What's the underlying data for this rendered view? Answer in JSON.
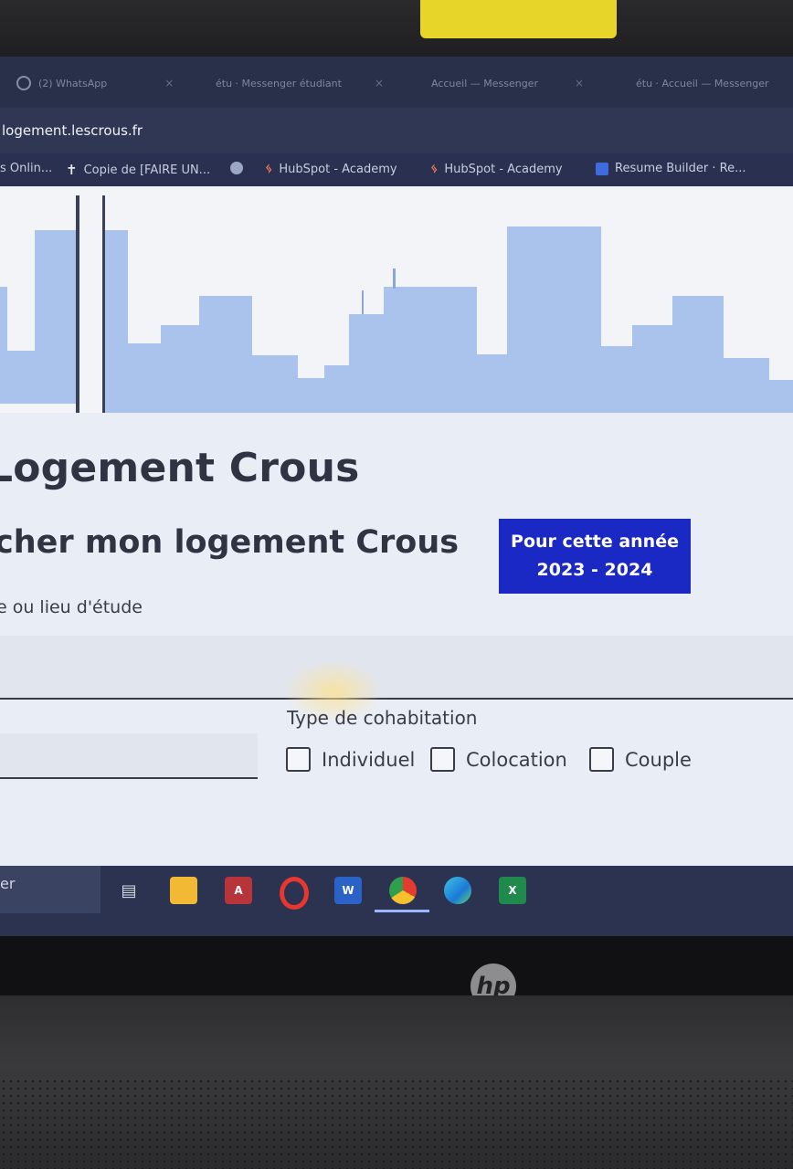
{
  "browser": {
    "tabs": [
      {
        "label": "(2) WhatsApp",
        "icon": "whatsapp-icon"
      },
      {
        "label": "étu · Messenger étudiant",
        "icon": "page-icon"
      },
      {
        "label": "Accueil — Messenger",
        "icon": "edge-icon"
      },
      {
        "label": "étu · Accueil — Messenger",
        "icon": "page-icon"
      }
    ],
    "url": "logement.lescrous.fr",
    "bookmarks": [
      {
        "label": "s Onlin...",
        "icon": "page-icon"
      },
      {
        "label": "Copie de [FAIRE UN...",
        "icon": "cross-icon"
      },
      {
        "label": "",
        "icon": "globe-icon"
      },
      {
        "label": "HubSpot - Academy",
        "icon": "hubspot-icon"
      },
      {
        "label": "HubSpot - Academy",
        "icon": "hubspot-icon"
      },
      {
        "label": "Resume Builder · Re...",
        "icon": "resume-builder-icon"
      }
    ]
  },
  "page": {
    "title": "Logement Crous",
    "subtitle": "cher mon logement Crous",
    "year_badge": {
      "line1": "Pour cette année",
      "line2": "2023 - 2024",
      "color": "#1a28c4"
    },
    "place_label": "e ou lieu d'étude",
    "cohabitation_label": "Type de cohabitation",
    "cohabitation_options": [
      "Individuel",
      "Colocation",
      "Couple"
    ]
  },
  "taskbar": {
    "search_text": "er",
    "apps": [
      "task-view-icon",
      "file-explorer-icon",
      "access-icon",
      "opera-icon",
      "word-icon",
      "chrome-icon",
      "edge-icon",
      "excel-icon"
    ]
  },
  "device": {
    "brand": "hp"
  }
}
